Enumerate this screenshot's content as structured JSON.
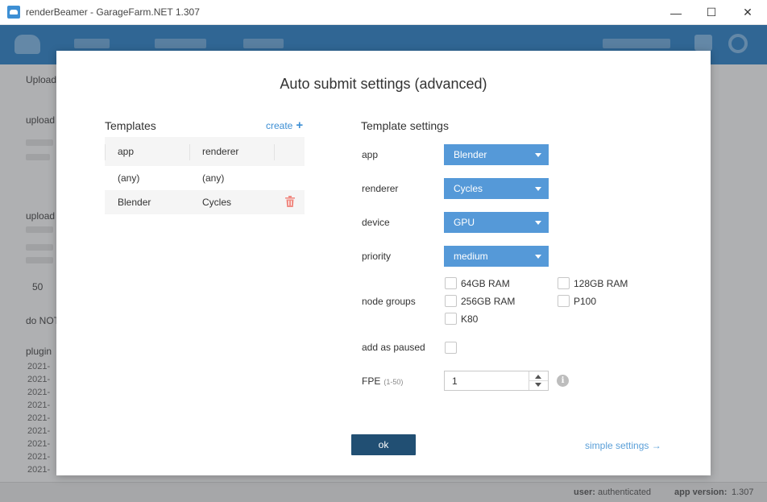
{
  "window": {
    "title": "renderBeamer - GarageFarm.NET 1.307",
    "minimize_glyph": "—",
    "maximize_glyph": "☐",
    "close_glyph": "✕"
  },
  "background": {
    "labels": [
      "Upload",
      "upload",
      "upload",
      "50",
      "do NOT",
      "plugin"
    ],
    "log_entries": [
      "2021-",
      "2021-",
      "2021-",
      "2021-",
      "2021-",
      "2021-",
      "2021-",
      "2021-",
      "2021-"
    ],
    "status_user_label": "user:",
    "status_user_value": "authenticated",
    "status_version_label": "app version:",
    "status_version_value": "1.307"
  },
  "dialog": {
    "title": "Auto submit settings (advanced)",
    "templates": {
      "heading": "Templates",
      "create_label": "create",
      "columns": [
        "app",
        "renderer"
      ],
      "rows": [
        {
          "app": "(any)",
          "renderer": "(any)"
        },
        {
          "app": "Blender",
          "renderer": "Cycles"
        }
      ]
    },
    "settings": {
      "heading": "Template settings",
      "app_label": "app",
      "app_value": "Blender",
      "renderer_label": "renderer",
      "renderer_value": "Cycles",
      "device_label": "device",
      "device_value": "GPU",
      "priority_label": "priority",
      "priority_value": "medium",
      "node_groups_label": "node groups",
      "node_groups": [
        {
          "label": "64GB RAM",
          "checked": false
        },
        {
          "label": "128GB RAM",
          "checked": false
        },
        {
          "label": "256GB RAM",
          "checked": false
        },
        {
          "label": "P100",
          "checked": false
        },
        {
          "label": "K80",
          "checked": false
        }
      ],
      "add_paused_label": "add as paused",
      "fpe_label": "FPE",
      "fpe_hint": "(1-50)",
      "fpe_value": "1"
    },
    "ok_label": "ok",
    "simple_settings_label": "simple settings →"
  },
  "colors": {
    "accent": "#5599d8",
    "primary_button": "#214f73",
    "link": "#3d8fd4",
    "delete": "#f08c84"
  }
}
